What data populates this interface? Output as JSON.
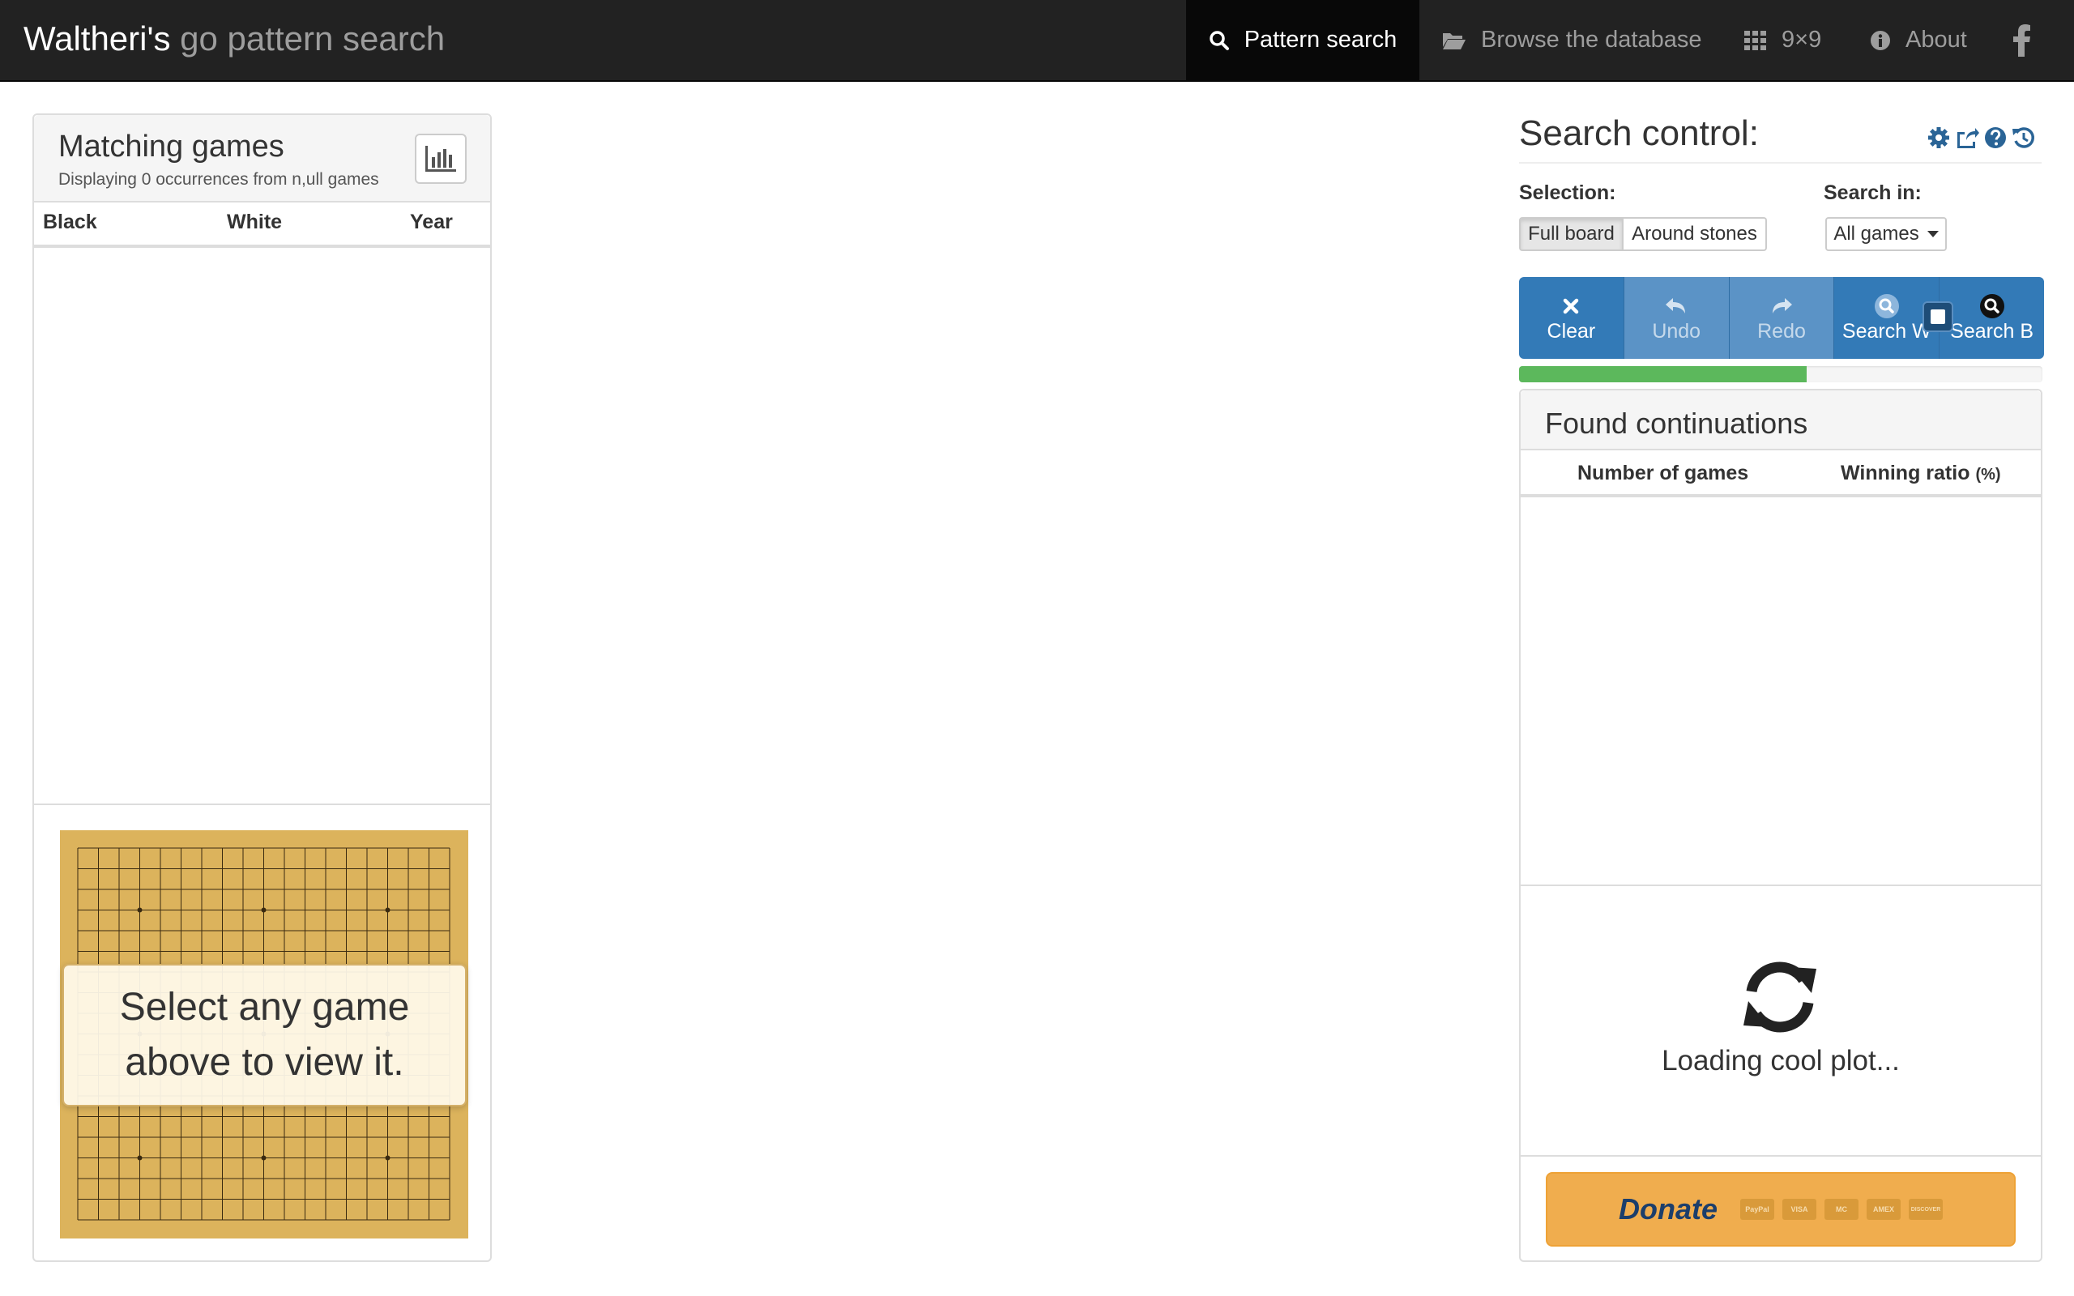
{
  "navbar": {
    "brand_main": "Waltheri's",
    "brand_sub": "go pattern search",
    "items": [
      {
        "label": "Pattern search",
        "icon": "search-icon",
        "active": true
      },
      {
        "label": "Browse the database",
        "icon": "folder-open-icon"
      },
      {
        "label": "9×9",
        "icon": "grid-icon"
      },
      {
        "label": "About",
        "icon": "info-icon"
      }
    ],
    "social_icon": "facebook-icon"
  },
  "matching_games": {
    "title": "Matching games",
    "subtitle": "Displaying 0 occurrences from n,ull games",
    "stats_icon": "bar-chart-icon",
    "columns": [
      "Black",
      "White",
      "Year"
    ],
    "rows": [],
    "board_overlay": "Select any game above to view it."
  },
  "search_control": {
    "title": "Search control:",
    "header_icons": [
      "gear-icon",
      "share-icon",
      "help-icon",
      "history-icon"
    ],
    "selection_label": "Selection:",
    "selection_options": [
      "Full board",
      "Around stones"
    ],
    "selection_active": "Full board",
    "search_in_label": "Search in:",
    "search_in_value": "All games",
    "toolbar": [
      {
        "label": "Clear",
        "icon": "close-icon"
      },
      {
        "label": "Undo",
        "icon": "undo-icon"
      },
      {
        "label": "Redo",
        "icon": "redo-icon"
      },
      {
        "label": "Search W",
        "icon": "search-white-icon"
      },
      {
        "label": "Search B",
        "icon": "search-black-icon"
      }
    ],
    "stop_icon": "stop-icon",
    "progress_fraction": 0.55
  },
  "continuations": {
    "title": "Found continuations",
    "col_games": "Number of games",
    "col_ratio": "Winning ratio",
    "col_ratio_unit": "(%)",
    "rows": [],
    "loading_icon": "refresh-icon",
    "loading_text": "Loading cool plot...",
    "donate_label": "Donate",
    "payment_cards": [
      "PayPal",
      "VISA",
      "MC",
      "AMEX",
      "DISCOVER"
    ]
  },
  "colors": {
    "navbar_bg": "#222222",
    "toolbar_blue": "#337ab7",
    "progress_green": "#5cb85c",
    "board_wood": "#dcb35c",
    "donate_orange": "#f0ad4e"
  }
}
